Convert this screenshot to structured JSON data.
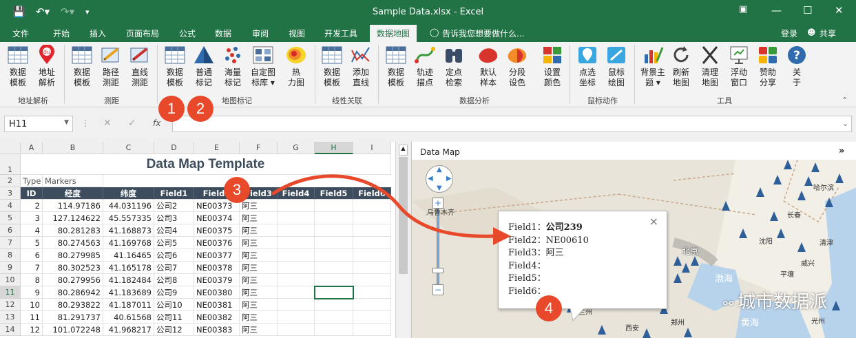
{
  "title_bar": {
    "title": "Sample Data.xlsx - Excel"
  },
  "tabs": [
    "文件",
    "开始",
    "插入",
    "页面布局",
    "公式",
    "数据",
    "审阅",
    "视图",
    "开发工具",
    "数据地图"
  ],
  "tell_me": "告诉我您想要做什么...",
  "login": "登录",
  "share": "共享",
  "ribbon": {
    "buttons": [
      "数据\n模板",
      "地址\n解析",
      "数据\n模板",
      "路径\n测距",
      "直线\n测距",
      "数据\n模板",
      "普通\n标记",
      "海量\n标记",
      "自定图\n标库 ▾",
      "热\n力图",
      "数据\n模板",
      "添加\n直线",
      "数据\n模板",
      "轨迹\n描点",
      "定点\n检索",
      "默认\n样本",
      "分段\n设色",
      "设置\n颜色",
      "点选\n坐标",
      "鼠标\n绘图",
      "背景主\n题 ▾",
      "刷新\n地图",
      "清理\n地图",
      "浮动\n窗口",
      "赞助\n分享",
      "关\n于"
    ],
    "groups": [
      "地址解析",
      "测距",
      "地图标记",
      "线性关联",
      "数据分析",
      "鼠标动作",
      "工具"
    ]
  },
  "formula_bar": {
    "name_box": "H11",
    "fx": "fx"
  },
  "badges": [
    "1",
    "2",
    "3",
    "4"
  ],
  "sheet": {
    "col_letters": [
      "A",
      "B",
      "C",
      "D",
      "E",
      "F",
      "G",
      "H",
      "I"
    ],
    "row_numbers": [
      "1",
      "2",
      "3",
      "4",
      "5",
      "6",
      "7",
      "8",
      "9",
      "10",
      "11",
      "12",
      "13",
      "14"
    ],
    "template_title": "Data Map Template",
    "type_label": "Type",
    "markers_label": "Markers",
    "headers": [
      "ID",
      "经度",
      "纬度",
      "Field1",
      "Field2",
      "Field3",
      "Field4",
      "Field5",
      "Field6"
    ],
    "rows": [
      [
        "2",
        "114.97186",
        "44.031196",
        "公司2",
        "NE00373",
        "阿三"
      ],
      [
        "3",
        "127.124622",
        "45.557335",
        "公司3",
        "NE00374",
        "阿三"
      ],
      [
        "4",
        "80.281283",
        "41.168873",
        "公司4",
        "NE00375",
        "阿三"
      ],
      [
        "5",
        "80.274563",
        "41.169768",
        "公司5",
        "NE00376",
        "阿三"
      ],
      [
        "6",
        "80.279985",
        "41.16465",
        "公司6",
        "NE00377",
        "阿三"
      ],
      [
        "7",
        "80.302523",
        "41.165178",
        "公司7",
        "NE00378",
        "阿三"
      ],
      [
        "8",
        "80.279956",
        "41.182484",
        "公司8",
        "NE00379",
        "阿三"
      ],
      [
        "9",
        "80.286942",
        "41.183689",
        "公司9",
        "NE00380",
        "阿三"
      ],
      [
        "10",
        "80.293822",
        "41.187011",
        "公司10",
        "NE00381",
        "阿三"
      ],
      [
        "11",
        "81.291737",
        "40.61568",
        "公司11",
        "NE00382",
        "阿三"
      ],
      [
        "12",
        "101.072248",
        "41.968217",
        "公司12",
        "NE00383",
        "阿三"
      ]
    ]
  },
  "map": {
    "panel_title": "Data Map",
    "popup": {
      "lines": [
        {
          "label": "Field1：",
          "value": "公司239"
        },
        {
          "label": "Field2：",
          "value": "NE00610"
        },
        {
          "label": "Field3：",
          "value": "阿三"
        },
        {
          "label": "Field4：",
          "value": ""
        },
        {
          "label": "Field5：",
          "value": ""
        },
        {
          "label": "Field6：",
          "value": ""
        }
      ],
      "close": "×"
    },
    "cities": [
      "乌鲁木齐",
      "哈尔滨",
      "长春",
      "北京",
      "沈阳",
      "渤海",
      "平壤",
      "威兴",
      "天津",
      "太原",
      "兰州",
      "郑州",
      "西安",
      "黄海",
      "光州",
      "清津"
    ],
    "watermark": "城市数据派"
  }
}
